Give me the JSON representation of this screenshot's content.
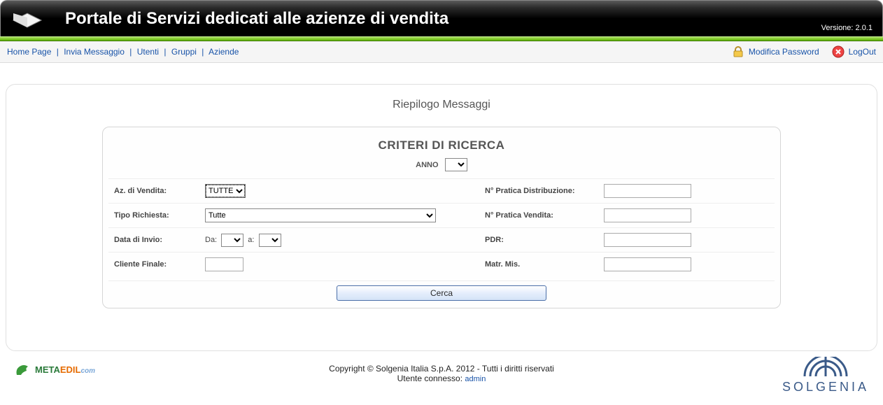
{
  "header": {
    "title": "Portale di Servizi dedicati alle azienze di vendita",
    "version_label": "Versione: 2.0.1"
  },
  "nav": {
    "links": [
      "Home Page",
      "Invia Messaggio",
      "Utenti",
      "Gruppi",
      "Aziende"
    ],
    "modify_password": "Modifica Password",
    "logout": "LogOut"
  },
  "page": {
    "heading": "Riepilogo Messaggi",
    "panel_title": "CRITERI DI RICERCA",
    "anno_label": "ANNO",
    "anno_value": "",
    "fields": {
      "az_vendita_label": "Az. di Vendita:",
      "az_vendita_value": "TUTTE",
      "tipo_richiesta_label": "Tipo Richiesta:",
      "tipo_richiesta_value": "Tutte",
      "data_invio_label": "Data di Invio:",
      "da_label": "Da:",
      "da_value": "",
      "a_label": "a:",
      "a_value": "",
      "cliente_finale_label": "Cliente Finale:",
      "cliente_finale_value": "",
      "pratica_dist_label": "N° Pratica Distribuzione:",
      "pratica_dist_value": "",
      "pratica_vend_label": "N° Pratica Vendita:",
      "pratica_vend_value": "",
      "pdr_label": "PDR:",
      "pdr_value": "",
      "matr_label": "Matr. Mis.",
      "matr_value": ""
    },
    "search_button": "Cerca"
  },
  "footer": {
    "copyright": "Copyright © Solgenia Italia S.p.A. 2012 - Tutti i diritti riservati",
    "user_label": "Utente connesso: ",
    "user": "admin",
    "left_logo_parts": {
      "p1": "META",
      "p2": "EDIL",
      "p3": "com"
    },
    "right_logo": "SOLGENIA"
  }
}
